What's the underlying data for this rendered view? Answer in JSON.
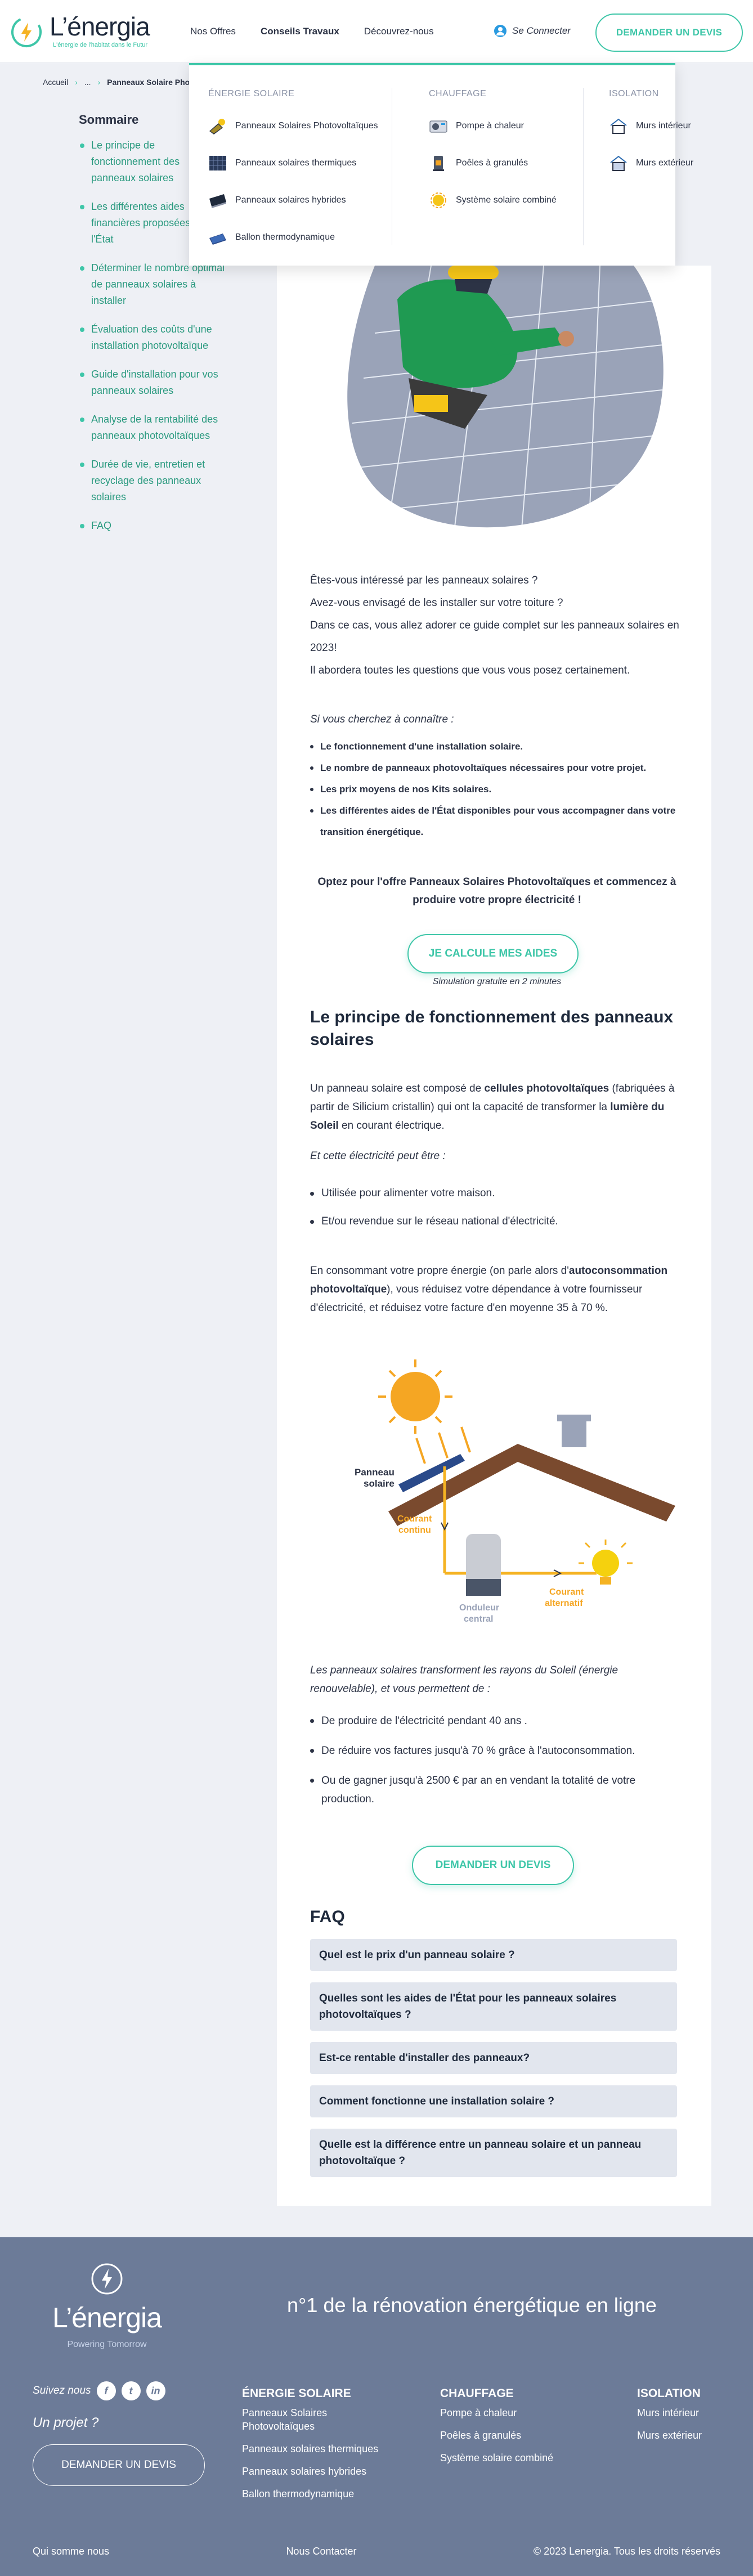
{
  "header": {
    "logo_text": "L’énergia",
    "logo_tagline": "L'énergie de l'habitat dans le Futur",
    "nav": [
      "Nos Offres",
      "Conseils Travaux",
      "Découvrez-nous"
    ],
    "active_nav": "Conseils Travaux",
    "connect_label": "Se Connecter",
    "devis_button": "DEMANDER UN DEVIS"
  },
  "breadcrumb": {
    "home": "Accueil",
    "ellipsis": "...",
    "current": "Panneaux Solaire Photo"
  },
  "mega_menu": {
    "columns": [
      {
        "title": "ÉNERGIE SOLAIRE",
        "items": [
          {
            "label": "Panneaux Solaires Photovoltaïques",
            "icon": "pv-panel-sun-icon"
          },
          {
            "label": "Panneaux solaires thermiques",
            "icon": "thermal-panel-icon"
          },
          {
            "label": "Panneaux solaires hybrides",
            "icon": "hybrid-panel-icon"
          },
          {
            "label": "Ballon thermodynamique",
            "icon": "water-heater-icon"
          }
        ]
      },
      {
        "title": "CHAUFFAGE",
        "items": [
          {
            "label": "Pompe à chaleur",
            "icon": "heat-pump-icon"
          },
          {
            "label": "Poêles à granulés",
            "icon": "pellet-stove-icon"
          },
          {
            "label": "Système solaire combiné",
            "icon": "combined-solar-icon"
          }
        ]
      },
      {
        "title": "ISOLATION",
        "items": [
          {
            "label": "Murs intérieur",
            "icon": "interior-wall-house-icon"
          },
          {
            "label": "Murs extérieur",
            "icon": "exterior-wall-house-icon"
          }
        ]
      }
    ]
  },
  "sommaire": {
    "title": "Sommaire",
    "items": [
      "Le principe de fonctionnement des panneaux solaires",
      "Les différentes aides financières proposées par l'État",
      "Déterminer le nombre optimal de panneaux solaires à installer",
      "Évaluation des coûts d'une installation photovoltaïque",
      "Guide d'installation pour vos panneaux solaires",
      "Analyse de la rentabilité des panneaux photovoltaïques",
      "Durée de vie, entretien et recyclage des panneaux solaires",
      "FAQ"
    ]
  },
  "article": {
    "intro": [
      "Êtes-vous intéressé par les panneaux solaires ?",
      "Avez-vous envisagé de les installer sur votre toiture ?",
      "Dans ce cas, vous allez adorer ce guide complet sur les panneaux solaires en 2023!",
      "Il abordera toutes les questions que vous vous posez certainement."
    ],
    "know_label": "Si vous cherchez à connaître :",
    "know_items": [
      "Le fonctionnement d'une installation solaire.",
      "Le nombre de panneaux photovoltaïques nécessaires pour votre projet.",
      "Les prix moyens de nos Kits solaires.",
      "Les différentes aides de l'État disponibles pour vous accompagner dans votre transition énergétique."
    ],
    "offer_text": "Optez pour l'offre Panneaux Solaires Photovoltaïques et commencez à produire votre propre électricité !",
    "aides_button": "JE CALCULE MES AIDES",
    "aides_note": "Simulation gratuite en 2 minutes",
    "section_title": "Le principe de fonctionnement des panneaux solaires",
    "p1_a": "Un panneau solaire est composé de ",
    "p1_b": "cellules photovoltaïques",
    "p1_c": " (fabriquées à partir de Silicium cristallin) qui ont la capacité de transformer la ",
    "p1_d": "lumière du Soleil",
    "p1_e": " en courant électrique.",
    "elec_label": "Et cette électricité peut être :",
    "elec_items": [
      "Utilisée pour alimenter votre maison.",
      "Et/ou revendue sur le réseau national d'électricité."
    ],
    "p2_a": "En consommant votre propre énergie (on parle alors d'",
    "p2_b": "autoconsommation photovoltaïque",
    "p2_c": "), vous réduisez votre dépendance à votre fournisseur d'électricité, et réduisez votre facture d'en moyenne 35 à 70 %.",
    "diagram_labels": {
      "panel": "Panneau solaire",
      "dc": "Courant continu",
      "ac": "Courant alternatif",
      "inverter": "Onduleur central"
    },
    "benefit_label": "Les panneaux solaires transforment les rayons du Soleil (énergie renouvelable), et vous permettent de :",
    "benefit_items": [
      "De produire de l'électricité pendant 40 ans .",
      "De réduire vos factures jusqu'à 70 % grâce à l'autoconsommation.",
      "Ou de gagner jusqu'à 2500 € par an en vendant la totalité de votre production."
    ],
    "devis_button": "DEMANDER UN DEVIS",
    "faq_title": "FAQ",
    "faq": [
      "Quel est le prix d'un panneau solaire ?",
      "Quelles sont les aides de l'État pour les panneaux solaires photovoltaïques ?",
      "Est-ce rentable d'installer des panneaux?",
      "Comment fonctionne une installation solaire ?",
      "Quelle est la différence entre un panneau solaire et un panneau photovoltaïque ?"
    ]
  },
  "footer": {
    "logo_text": "L’énergia",
    "logo_tagline": "Powering Tomorrow",
    "headline": "n°1 de la rénovation énergétique en ligne",
    "follow_label": "Suivez nous",
    "social": [
      "f",
      "t",
      "in"
    ],
    "project_label": "Un projet ?",
    "devis_button": "DEMANDER UN DEVIS",
    "columns": [
      {
        "title": "ÉNERGIE SOLAIRE",
        "items": [
          "Panneaux Solaires Photovoltaïques",
          "Panneaux solaires thermiques",
          "Panneaux solaires hybrides",
          "Ballon thermodynamique"
        ]
      },
      {
        "title": "CHAUFFAGE",
        "items": [
          "Pompe à chaleur",
          "Poêles à granulés",
          "Système solaire combiné"
        ]
      },
      {
        "title": "ISOLATION",
        "items": [
          "Murs intérieur",
          "Murs extérieur"
        ]
      }
    ],
    "bottom": [
      "Qui somme nous",
      "Nous Contacter",
      "© 2023 Lenergia. Tous les droits réservés"
    ]
  },
  "colors": {
    "accent": "#3ec6a8",
    "text": "#2c3345",
    "footer_bg": "#6c7b98",
    "page_bg": "#eef0f5"
  }
}
